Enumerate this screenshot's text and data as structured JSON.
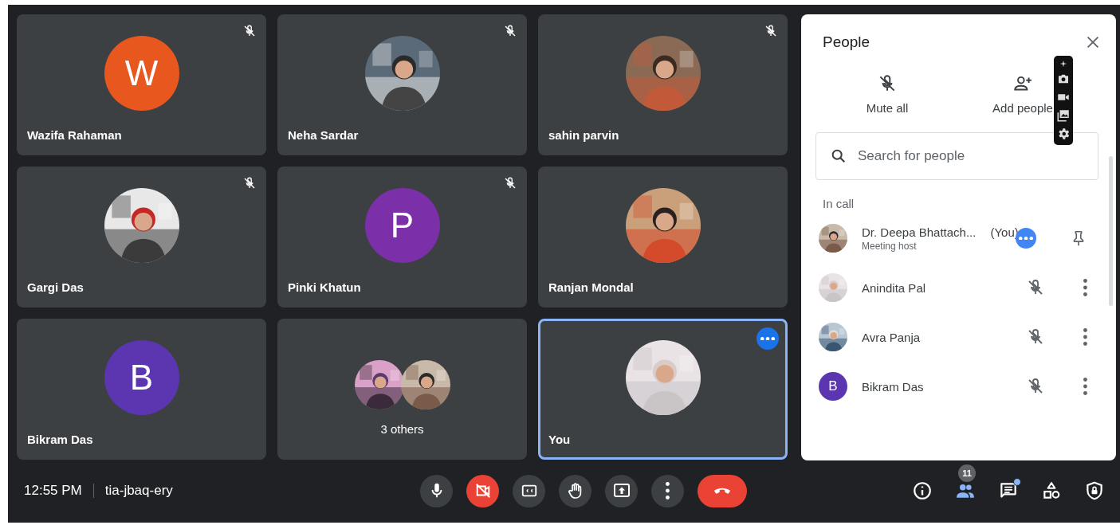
{
  "tiles": [
    {
      "name": "Wazifa Rahaman",
      "avatar": {
        "kind": "letter",
        "letter": "W",
        "color": "#e8571e"
      },
      "muted": true,
      "selected": false
    },
    {
      "name": "Neha Sardar",
      "muted": true,
      "selected": false
    },
    {
      "name": "sahin parvin",
      "muted": true,
      "selected": false
    },
    {
      "name": "Gargi Das",
      "muted": true,
      "selected": false
    },
    {
      "name": "Pinki Khatun",
      "avatar": {
        "kind": "letter",
        "letter": "P",
        "color": "#7b2fa8"
      },
      "muted": true,
      "selected": false
    },
    {
      "name": "Ranjan Mondal",
      "muted": false,
      "selected": false
    },
    {
      "name": "Bikram Das",
      "avatar": {
        "kind": "letter",
        "letter": "B",
        "color": "#5b36b0"
      },
      "muted": false,
      "selected": false
    },
    {
      "kind": "others",
      "label": "3 others",
      "selected": false
    },
    {
      "name": "You",
      "muted": false,
      "selected": true
    }
  ],
  "people_panel": {
    "title": "People",
    "actions": [
      {
        "kind": "mute",
        "label": "Mute all"
      },
      {
        "kind": "add",
        "label": "Add people"
      }
    ],
    "search": {
      "placeholder": "Search for people"
    },
    "section": "In call",
    "participants": [
      {
        "kind": "host",
        "name": "Dr. Deepa Bhattach...",
        "suffix": "(You)",
        "subtitle": "Meeting host"
      },
      {
        "kind": "participant",
        "name": "Anindita Pal"
      },
      {
        "kind": "participant",
        "name": "Avra Panja"
      },
      {
        "kind": "participant",
        "name": "Bikram Das",
        "avatar": {
          "kind": "letter",
          "letter": "B",
          "color": "#5b36b0"
        }
      }
    ]
  },
  "call_bar": {
    "time": "12:55 PM",
    "meeting_code": "tia-jbaq-ery",
    "mic_on": true,
    "camera_on": false,
    "people_count": "11",
    "chat_unread": true
  }
}
